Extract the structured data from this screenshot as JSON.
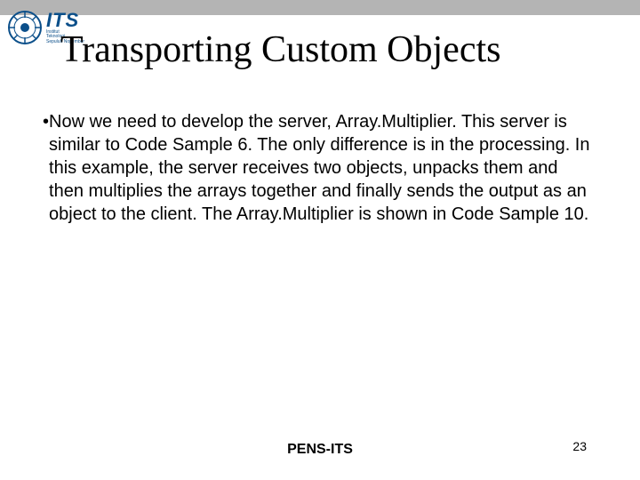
{
  "logo": {
    "acronym": "ITS",
    "sub1": "Institut",
    "sub2": "Teknologi",
    "sub3": "Sepuluh Nopember"
  },
  "title": "Transporting Custom Objects",
  "bullet": "•",
  "paragraph": "Now we need to develop the server, Array.Multiplier. This server is similar to Code Sample 6. The only difference is in the processing. In this example, the server receives two objects, unpacks them and then multiplies the arrays together and finally sends the output as an object to the client. The Array.Multiplier is shown in Code Sample 10.",
  "footer": {
    "center": "PENS-ITS",
    "page": "23"
  }
}
